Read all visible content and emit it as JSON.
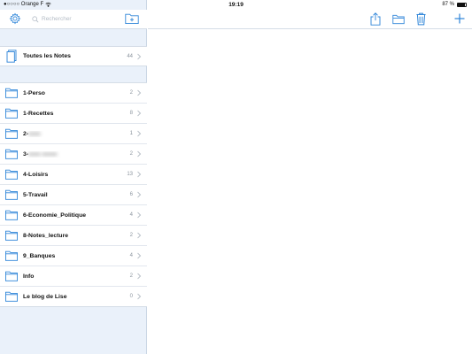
{
  "status_bar": {
    "carrier": "●○○○○ Orange F",
    "time": "19:19",
    "battery_percent": "87 %",
    "battery_level": 0.87
  },
  "sidebar": {
    "search_placeholder": "Rechercher",
    "all_notes": {
      "label": "Toutes les Notes",
      "count": "44"
    },
    "folders": [
      {
        "label": "1-Perso",
        "count": "2"
      },
      {
        "label": "1-Recettes",
        "count": "8"
      },
      {
        "label": "2-",
        "blurred": "xxxx",
        "count": "1"
      },
      {
        "label": "3-",
        "blurred": "xxxx xxxxx",
        "count": "2"
      },
      {
        "label": "4-Loisirs",
        "count": "13"
      },
      {
        "label": "5-Travail",
        "count": "6"
      },
      {
        "label": "6-Economie_Politique",
        "count": "4"
      },
      {
        "label": "8-Notes_lecture",
        "count": "2"
      },
      {
        "label": "9_Banques",
        "count": "4"
      },
      {
        "label": "Info",
        "count": "2"
      },
      {
        "label": "Le blog de Lise",
        "count": "0"
      }
    ]
  },
  "toolbar": {
    "icons": [
      "share-icon",
      "move-to-folder-icon",
      "trash-icon",
      "plus-icon"
    ]
  },
  "colors": {
    "accent": "#2d84d8",
    "sidebar_background": "#eaf1fa",
    "count_text": "#8a939d"
  }
}
